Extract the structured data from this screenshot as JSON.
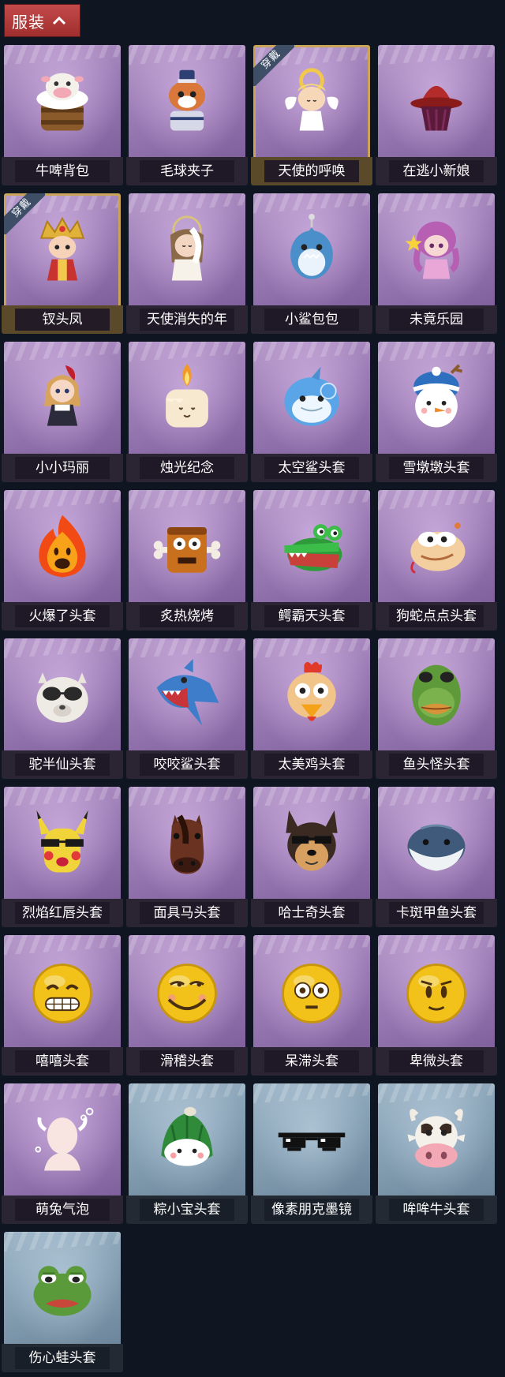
{
  "header": {
    "tab_label": "服装"
  },
  "equipped_badge": "穿戴",
  "items": [
    {
      "name": "牛啤背包",
      "theme": "purple",
      "equipped": false,
      "icon": "cow-beer-backpack-icon"
    },
    {
      "name": "毛球夹子",
      "theme": "purple",
      "equipped": false,
      "icon": "raccoon-drummer-icon"
    },
    {
      "name": "天使的呼唤",
      "theme": "purple",
      "equipped": true,
      "icon": "angel-icon"
    },
    {
      "name": "在逃小新娘",
      "theme": "purple",
      "equipped": false,
      "icon": "runaway-bride-hat-icon"
    },
    {
      "name": "钗头凤",
      "theme": "purple",
      "equipped": true,
      "icon": "phoenix-crown-doll-icon"
    },
    {
      "name": "天使消失的年",
      "theme": "purple",
      "equipped": false,
      "icon": "fallen-angel-doll-icon"
    },
    {
      "name": "小鲨包包",
      "theme": "purple",
      "equipped": false,
      "icon": "shark-bag-icon"
    },
    {
      "name": "未竟乐园",
      "theme": "purple",
      "equipped": false,
      "icon": "fairy-doll-icon"
    },
    {
      "name": "小小玛丽",
      "theme": "purple",
      "equipped": false,
      "icon": "little-mary-doll-icon"
    },
    {
      "name": "烛光纪念",
      "theme": "purple",
      "equipped": false,
      "icon": "candle-icon"
    },
    {
      "name": "太空鲨头套",
      "theme": "purple",
      "equipped": false,
      "icon": "space-shark-head-icon"
    },
    {
      "name": "雪墩墩头套",
      "theme": "purple",
      "equipped": false,
      "icon": "snowman-head-icon"
    },
    {
      "name": "火爆了头套",
      "theme": "purple",
      "equipped": false,
      "icon": "fire-head-icon"
    },
    {
      "name": "炙热烧烤",
      "theme": "purple",
      "equipped": false,
      "icon": "bbq-meat-head-icon"
    },
    {
      "name": "鳄霸天头套",
      "theme": "purple",
      "equipped": false,
      "icon": "crocodile-head-icon"
    },
    {
      "name": "狗蛇点点头套",
      "theme": "purple",
      "equipped": false,
      "icon": "dog-snake-head-icon"
    },
    {
      "name": "驼半仙头套",
      "theme": "purple",
      "equipped": false,
      "icon": "alpaca-sunglasses-head-icon"
    },
    {
      "name": "咬咬鲨头套",
      "theme": "purple",
      "equipped": false,
      "icon": "biting-shark-head-icon"
    },
    {
      "name": "太美鸡头套",
      "theme": "purple",
      "equipped": false,
      "icon": "chicken-head-icon"
    },
    {
      "name": "鱼头怪头套",
      "theme": "purple",
      "equipped": false,
      "icon": "fish-monster-head-icon"
    },
    {
      "name": "烈焰红唇头套",
      "theme": "purple",
      "equipped": false,
      "icon": "yellow-mouse-head-icon"
    },
    {
      "name": "面具马头套",
      "theme": "purple",
      "equipped": false,
      "icon": "horse-mask-head-icon"
    },
    {
      "name": "哈士奇头套",
      "theme": "purple",
      "equipped": false,
      "icon": "husky-head-icon"
    },
    {
      "name": "卡斑甲鱼头套",
      "theme": "purple",
      "equipped": false,
      "icon": "turtle-head-icon"
    },
    {
      "name": "嘻嘻头套",
      "theme": "purple",
      "equipped": false,
      "icon": "grinning-emoji-head-icon"
    },
    {
      "name": "滑稽头套",
      "theme": "purple",
      "equipped": false,
      "icon": "funny-emoji-head-icon"
    },
    {
      "name": "呆滞头套",
      "theme": "purple",
      "equipped": false,
      "icon": "dazed-emoji-head-icon"
    },
    {
      "name": "卑微头套",
      "theme": "purple",
      "equipped": false,
      "icon": "humble-emoji-head-icon"
    },
    {
      "name": "萌兔气泡",
      "theme": "purple",
      "equipped": false,
      "icon": "bunny-bubble-icon"
    },
    {
      "name": "粽小宝头套",
      "theme": "blue",
      "equipped": false,
      "icon": "zongzi-head-icon"
    },
    {
      "name": "像素朋克墨镜",
      "theme": "blue",
      "equipped": false,
      "icon": "pixel-sunglasses-icon"
    },
    {
      "name": "哞哞牛头套",
      "theme": "blue",
      "equipped": false,
      "icon": "cow-head-icon"
    },
    {
      "name": "伤心蛙头套",
      "theme": "blue",
      "equipped": false,
      "icon": "sad-frog-head-icon"
    }
  ]
}
